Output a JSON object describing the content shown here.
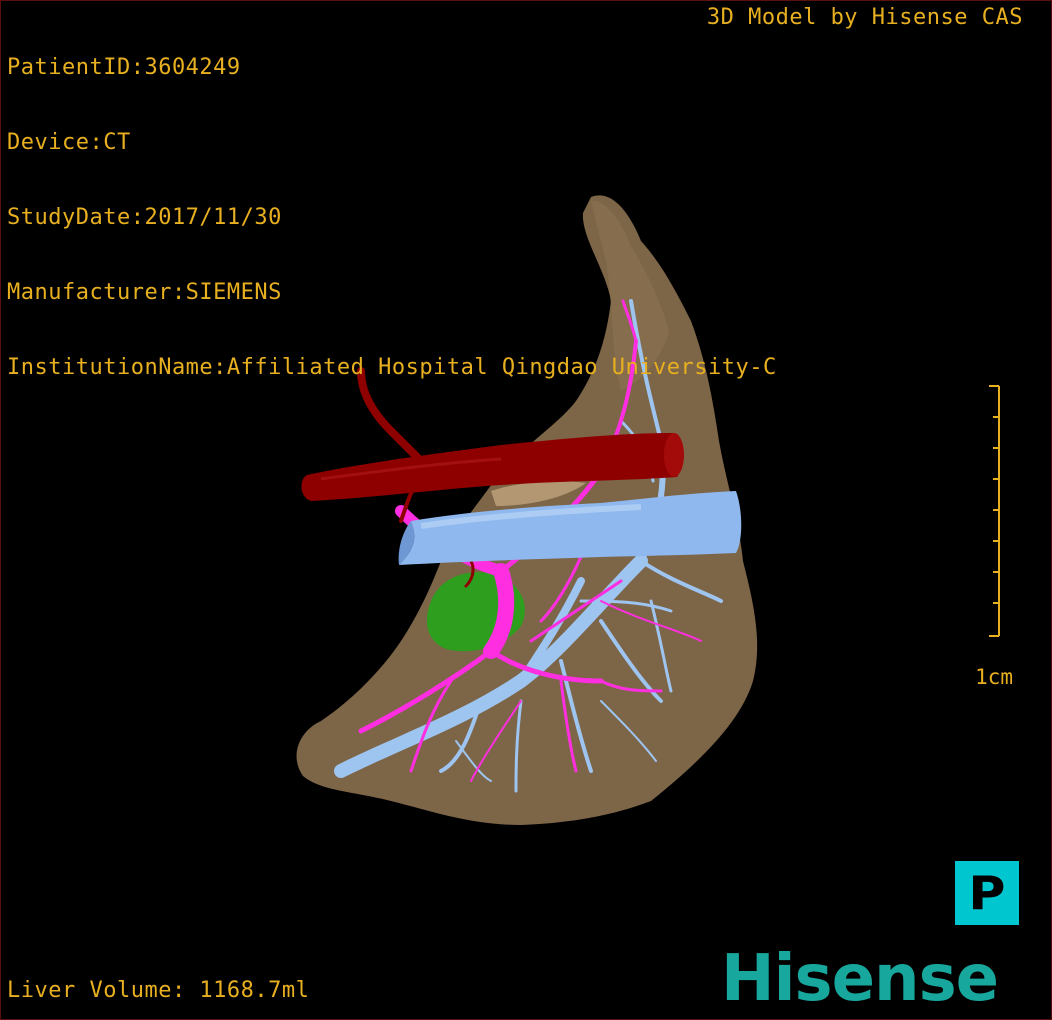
{
  "info": {
    "patient_id": "PatientID:3604249",
    "device": "Device:CT",
    "study_date": "StudyDate:2017/11/30",
    "manufacturer": "Manufacturer:SIEMENS",
    "institution": "InstitutionName:Affiliated Hospital Qingdao University-C"
  },
  "branding_text": "3D Model by Hisense CAS",
  "scale": {
    "label": "1cm"
  },
  "liver_volume": "Liver Volume: 1168.7ml",
  "orientation": {
    "label": "P"
  },
  "logo": {
    "text": "Hisense"
  },
  "colors": {
    "overlay_text": "#e8b020",
    "liver": "#7d6548",
    "artery": "#8e0000",
    "portal_vein": "#ff2ee0",
    "hepatic_vein": "#9ec4f0",
    "ivc": "#8fb8ee",
    "gallbladder": "#2e9e1e",
    "orientation_box": "#00c7cf",
    "logo": "#18a79d"
  }
}
